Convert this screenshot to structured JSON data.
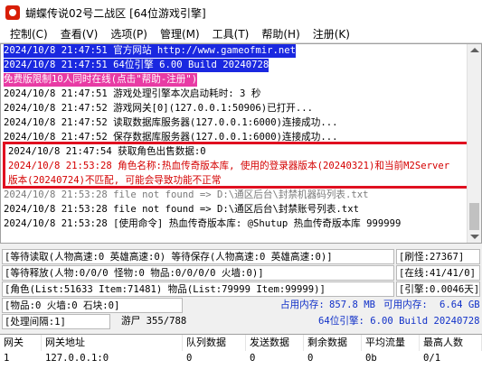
{
  "window": {
    "title": "蝴蝶传说02号二战区 [64位游戏引擎]"
  },
  "menu": [
    {
      "label": "控制(C)"
    },
    {
      "label": "查看(V)"
    },
    {
      "label": "选项(P)"
    },
    {
      "label": "管理(M)"
    },
    {
      "label": "工具(T)"
    },
    {
      "label": "帮助(H)"
    },
    {
      "label": "注册(K)"
    }
  ],
  "log": [
    {
      "text": "2024/10/8 21:47:51 官方网站 http://www.gameofmir.net",
      "style": "blue"
    },
    {
      "text": "2024/10/8 21:47:51 64位引擎 6.00 Build 20240728",
      "style": "blue"
    },
    {
      "text": "免费版限制10人同时在线(点击\"帮助-注册\")",
      "style": "pink"
    },
    {
      "text": "2024/10/8 21:47:51 游戏处理引擎本次启动耗时: 3 秒",
      "style": "normal"
    },
    {
      "text": "2024/10/8 21:47:52 游戏网关[0](127.0.0.1:50906)已打开...",
      "style": "normal"
    },
    {
      "text": "2024/10/8 21:47:52 读取数据库服务器(127.0.0.1:6000)连接成功...",
      "style": "normal"
    },
    {
      "text": "2024/10/8 21:47:52 保存数据库服务器(127.0.0.1:6000)连接成功...",
      "style": "normal"
    },
    {
      "text": "2024/10/8 21:47:54 获取角色出售数据:0",
      "style": "normal"
    },
    {
      "text": "2024/10/8 21:53:28 角色名称:热血传奇版本库, 使用的登录器版本(20240321)和当前M2Server",
      "style": "red"
    },
    {
      "text": "版本(20240724)不匹配, 可能会导致功能不正常",
      "style": "red"
    },
    {
      "text": "2024/10/8 21:53:28 file not found => D:\\通区后台\\封禁机器码列表.txt",
      "style": "normal"
    },
    {
      "text": "2024/10/8 21:53:28 file not found => D:\\通区后台\\封禁账号列表.txt",
      "style": "normal"
    },
    {
      "text": "2024/10/8 21:53:28 [使用命令] 热血传奇版本库: @Shutup 热血传奇版本库 999999",
      "style": "normal"
    }
  ],
  "status": {
    "row1_left": "[等待读取(人物高速:0 英雄高速:0) 等待保存(人物高速:0 英雄高速:0)]",
    "row1_right": "[刷怪:27367]",
    "row2_left": "[等待释放(人物:0/0/0 怪物:0 物品:0/0/0/0 火墙:0)]",
    "row2_right": "[在线:41/41/0]",
    "row3_left": "[角色(List:51633 Item:71481) 物品(List:79999 Item:99999)]",
    "row3_right": "[引擎:0.0046天]",
    "row4_left": "[物品:0 火墙:0 石块:0]",
    "row4_mem_used_label": "占用内存:",
    "row4_mem_used_value": "857.8 MB",
    "row4_mem_avail_label": "可用内存:",
    "row4_mem_avail_value": "6.64 GB",
    "row5_left": "[处理间隔:1]",
    "row5_mid": "游尸 355/788",
    "row5_right": "64位引擎: 6.00 Build 20240728"
  },
  "table": {
    "headers": [
      "网关",
      "网关地址",
      "队列数据",
      "发送数据",
      "剩余数据",
      "平均流量",
      "最高人数"
    ],
    "rows": [
      [
        "1",
        "127.0.0.1:0",
        "0",
        "0",
        "0",
        "0b",
        "0/1"
      ]
    ]
  }
}
